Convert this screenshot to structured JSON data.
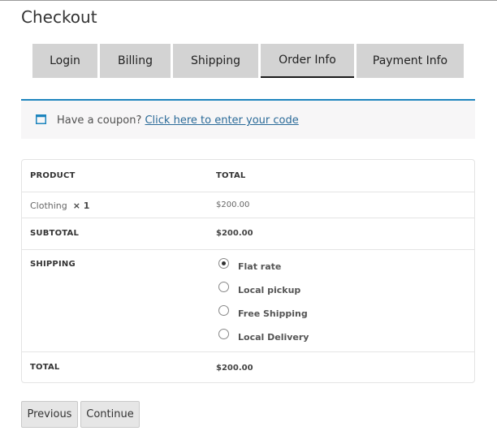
{
  "page": {
    "title": "Checkout"
  },
  "tabs": [
    {
      "label": "Login"
    },
    {
      "label": "Billing"
    },
    {
      "label": "Shipping"
    },
    {
      "label": "Order Info",
      "active": true
    },
    {
      "label": "Payment Info"
    }
  ],
  "coupon": {
    "icon": "window-icon",
    "prompt": "Have a coupon? ",
    "link_text": "Click here to enter your code",
    "accent_color": "#1e85be"
  },
  "order_table": {
    "headers": {
      "product": "PRODUCT",
      "total": "TOTAL"
    },
    "items": [
      {
        "name": "Clothing",
        "qty": "× 1",
        "total": "$200.00"
      }
    ],
    "subtotal": {
      "label": "SUBTOTAL",
      "value": "$200.00"
    },
    "shipping": {
      "label": "SHIPPING",
      "options": [
        {
          "label": "Flat rate",
          "selected": true
        },
        {
          "label": "Local pickup",
          "selected": false
        },
        {
          "label": "Free Shipping",
          "selected": false
        },
        {
          "label": "Local Delivery",
          "selected": false
        }
      ]
    },
    "total": {
      "label": "TOTAL",
      "value": "$200.00"
    }
  },
  "buttons": {
    "previous": "Previous",
    "continue": "Continue"
  }
}
